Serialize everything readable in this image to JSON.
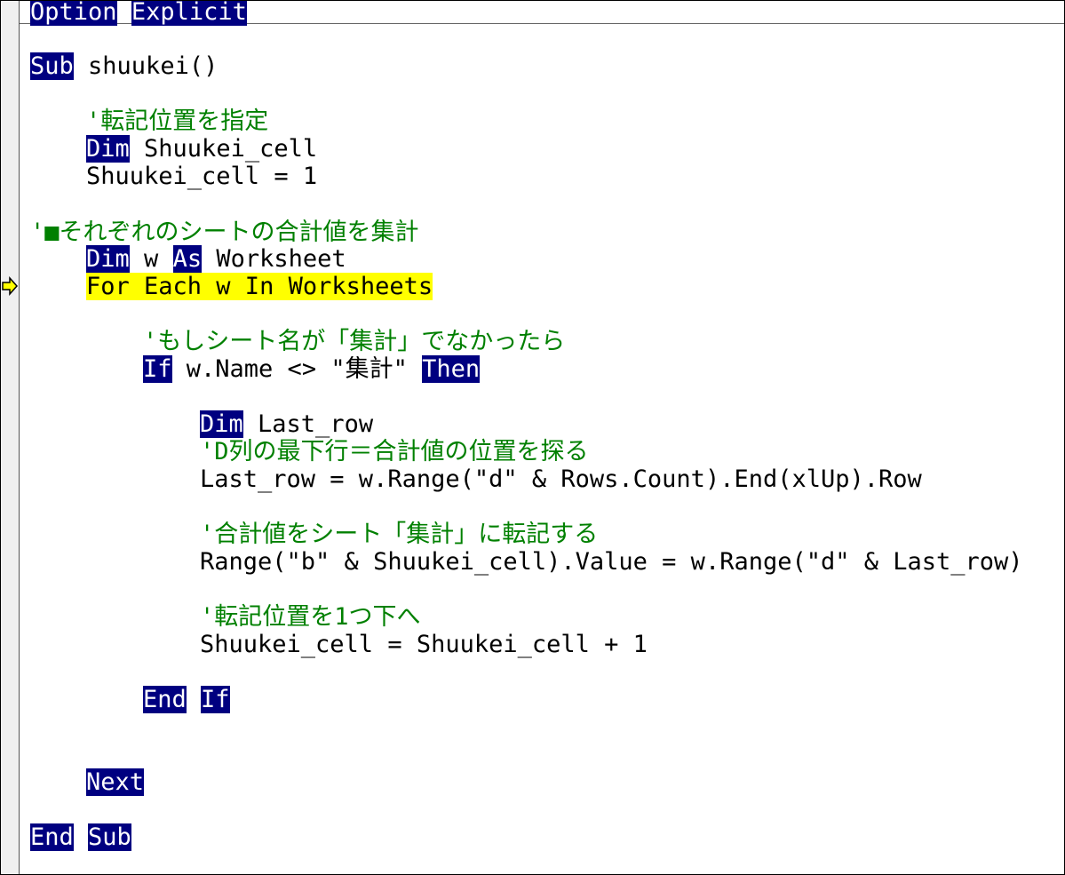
{
  "code": {
    "line1": {
      "kw1": "Option",
      "kw2": "Explicit"
    },
    "line2": {
      "kw": "Sub",
      "text": " shuukei()"
    },
    "line3": {
      "comment": "'転記位置を指定"
    },
    "line4": {
      "kw": "Dim",
      "text": " Shuukei_cell"
    },
    "line5": {
      "text": "Shuukei_cell = 1"
    },
    "line6": {
      "comment": "'■それぞれのシートの合計値を集計"
    },
    "line7": {
      "kw1": "Dim",
      "text1": " w ",
      "kw2": "As",
      "text2": " Worksheet"
    },
    "line8": {
      "text": "For Each w In Worksheets"
    },
    "line9": {
      "comment": "'もしシート名が「集計」でなかったら"
    },
    "line10": {
      "kw1": "If",
      "text": " w.Name <> \"集計\" ",
      "kw2": "Then"
    },
    "line11": {
      "kw": "Dim",
      "text": " Last_row"
    },
    "line12": {
      "comment": "'D列の最下行＝合計値の位置を探る"
    },
    "line13": {
      "text": "Last_row = w.Range(\"d\" & Rows.Count).End(xlUp).Row"
    },
    "line14": {
      "comment": "'合計値をシート「集計」に転記する"
    },
    "line15": {
      "text": "Range(\"b\" & Shuukei_cell).Value = w.Range(\"d\" & Last_row)"
    },
    "line16": {
      "comment": "'転記位置を1つ下へ"
    },
    "line17": {
      "text": "Shuukei_cell = Shuukei_cell + 1"
    },
    "line18": {
      "kw1": "End",
      "kw2": "If"
    },
    "line19": {
      "kw": "Next"
    },
    "line20": {
      "kw1": "End",
      "kw2": "Sub"
    }
  },
  "colors": {
    "keyword_bg": "#000080",
    "keyword_fg": "#ffffff",
    "comment": "#008000",
    "current_line_highlight": "#ffff00",
    "execution_arrow": "#ffff00"
  },
  "icons": {
    "execution_pointer": "execution-arrow-icon"
  }
}
